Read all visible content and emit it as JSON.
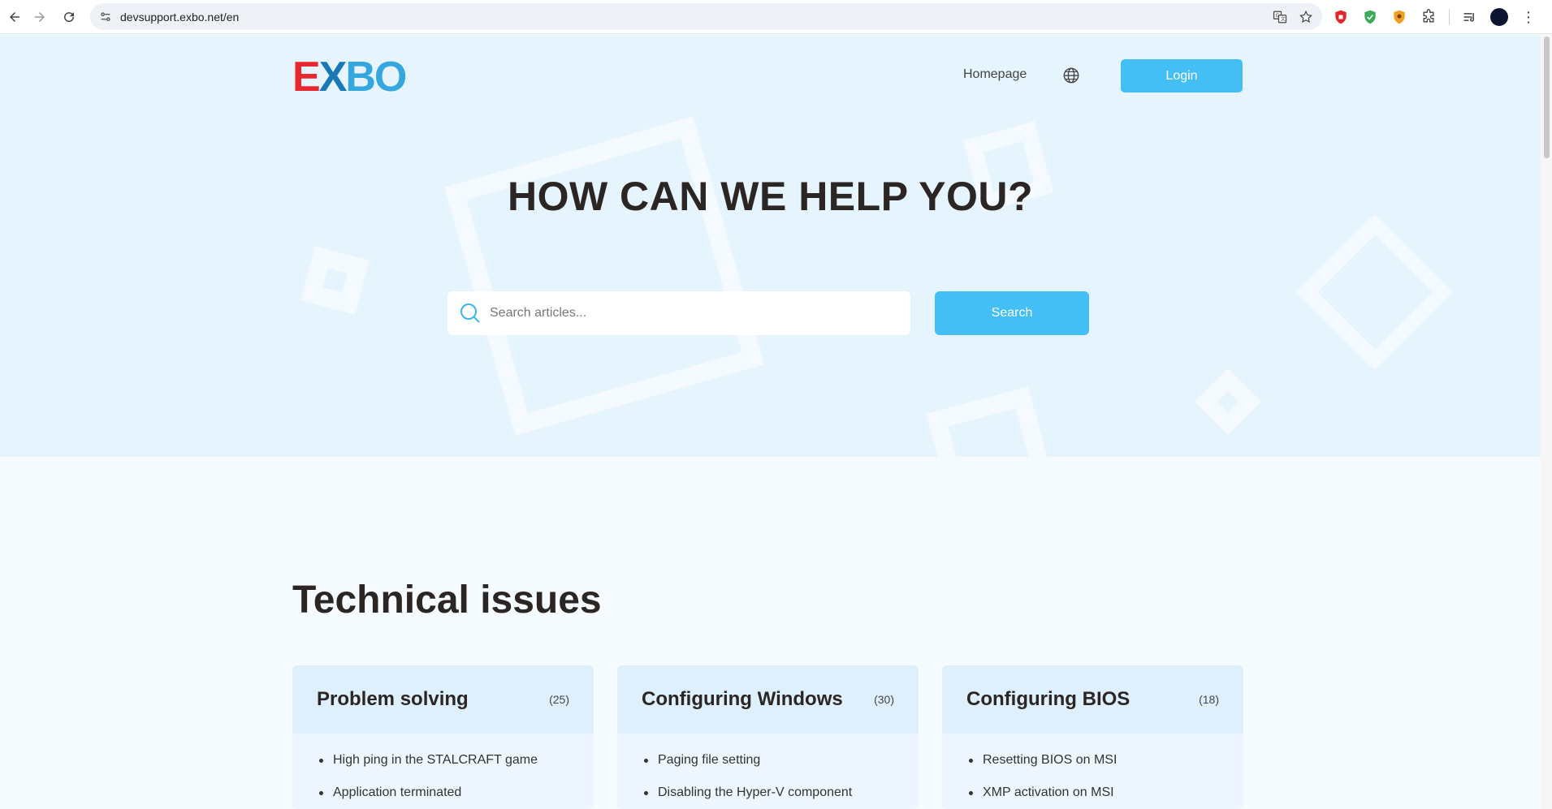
{
  "browser": {
    "url": "devsupport.exbo.net/en"
  },
  "header": {
    "logo": {
      "e": "E",
      "x": "X",
      "bo": "BO"
    },
    "nav_home": "Homepage",
    "login_label": "Login"
  },
  "hero": {
    "title": "HOW CAN WE HELP YOU?",
    "search_placeholder": "Search articles...",
    "search_label": "Search"
  },
  "section": {
    "title": "Technical issues",
    "cards": [
      {
        "title": "Problem solving",
        "count": "(25)",
        "items": [
          "High ping in the STALCRAFT game",
          "Application terminated"
        ]
      },
      {
        "title": "Configuring Windows",
        "count": "(30)",
        "items": [
          "Paging file setting",
          "Disabling the Hyper-V component"
        ]
      },
      {
        "title": "Configuring BIOS",
        "count": "(18)",
        "items": [
          "Resetting BIOS on MSI",
          "XMP activation on MSI"
        ]
      }
    ]
  },
  "colors": {
    "accent": "#43bff5",
    "hero_bg": "#e6f4fe",
    "logo_red": "#e8282e",
    "logo_blue": "#34a7df"
  }
}
